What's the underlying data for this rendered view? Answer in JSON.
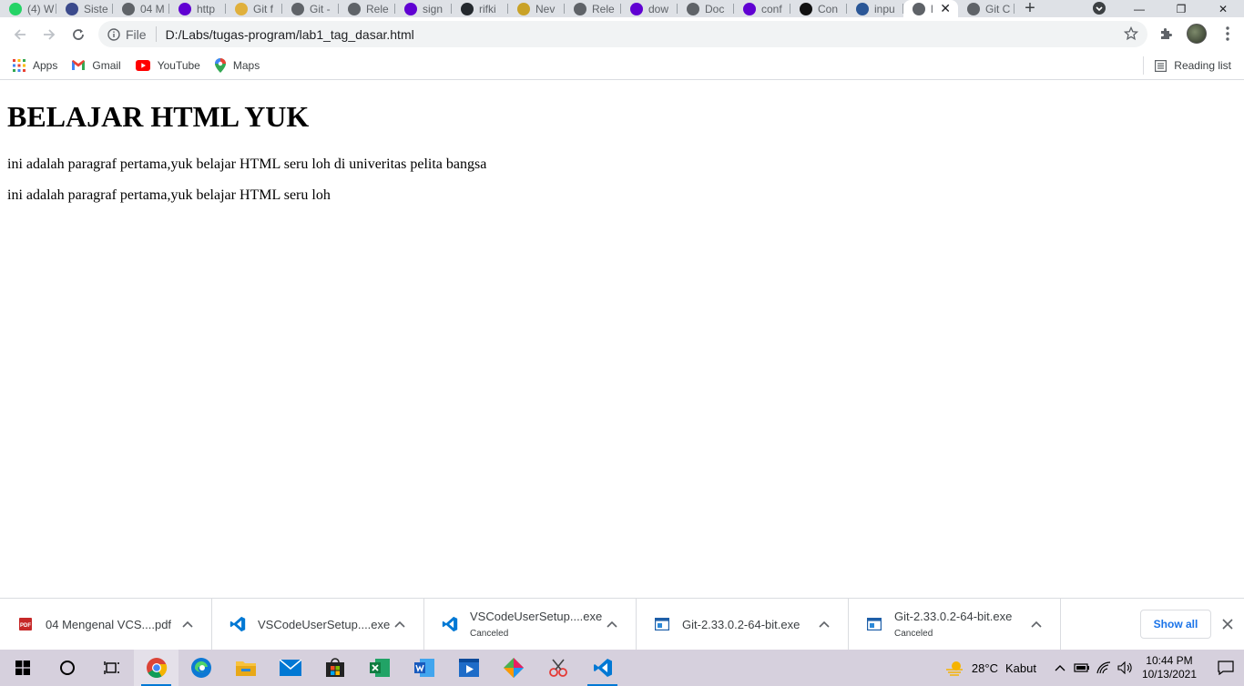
{
  "tabs": [
    {
      "title": "(4) W",
      "icon": "whatsapp-icon",
      "color": "#25d366"
    },
    {
      "title": "Siste",
      "icon": "site-icon",
      "color": "#3b4a8c"
    },
    {
      "title": "04 M",
      "icon": "globe-icon",
      "color": "#5f6368"
    },
    {
      "title": "http",
      "icon": "yahoo-icon",
      "color": "#6001d2"
    },
    {
      "title": "Git f",
      "icon": "git-icon",
      "color": "#e0b03c"
    },
    {
      "title": "Git -",
      "icon": "globe-icon",
      "color": "#5f6368"
    },
    {
      "title": "Rele",
      "icon": "globe-icon",
      "color": "#5f6368"
    },
    {
      "title": "sign",
      "icon": "yahoo-icon",
      "color": "#6001d2"
    },
    {
      "title": "rifki",
      "icon": "github-icon",
      "color": "#24292e"
    },
    {
      "title": "Nev",
      "icon": "crown-icon",
      "color": "#c9a227"
    },
    {
      "title": "Rele",
      "icon": "globe-icon",
      "color": "#5f6368"
    },
    {
      "title": "dow",
      "icon": "yahoo-icon",
      "color": "#6001d2"
    },
    {
      "title": "Doc",
      "icon": "globe-icon",
      "color": "#5f6368"
    },
    {
      "title": "conf",
      "icon": "yahoo-icon",
      "color": "#6001d2"
    },
    {
      "title": "Con",
      "icon": "site-icon",
      "color": "#111111"
    },
    {
      "title": "inpu",
      "icon": "site-icon",
      "color": "#2b5797"
    },
    {
      "title": "l",
      "icon": "globe-icon",
      "color": "#5f6368",
      "active": true
    },
    {
      "title": "Git C",
      "icon": "globe-icon",
      "color": "#5f6368"
    }
  ],
  "address": {
    "scheme_label": "File",
    "url": "D:/Labs/tugas-program/lab1_tag_dasar.html"
  },
  "bookmarks": [
    {
      "label": "Apps",
      "icon": "apps-grid-icon"
    },
    {
      "label": "Gmail",
      "icon": "gmail-icon"
    },
    {
      "label": "YouTube",
      "icon": "youtube-icon"
    },
    {
      "label": "Maps",
      "icon": "maps-icon"
    }
  ],
  "reading_list": "Reading list",
  "page": {
    "heading": "BELAJAR HTML YUK",
    "paragraph1": "ini adalah paragraf pertama,yuk belajar HTML seru loh di univeritas pelita bangsa",
    "paragraph2": "ini adalah paragraf pertama,yuk belajar HTML seru loh"
  },
  "downloads": [
    {
      "name": "04 Mengenal VCS....pdf",
      "status": "",
      "icon": "pdf-icon"
    },
    {
      "name": "VSCodeUserSetup....exe",
      "status": "",
      "icon": "vscode-icon"
    },
    {
      "name": "VSCodeUserSetup....exe",
      "status": "Canceled",
      "icon": "vscode-icon"
    },
    {
      "name": "Git-2.33.0.2-64-bit.exe",
      "status": "",
      "icon": "installer-icon"
    },
    {
      "name": "Git-2.33.0.2-64-bit.exe",
      "status": "Canceled",
      "icon": "installer-icon"
    }
  ],
  "show_all": "Show all",
  "taskbar": {
    "weather_temp": "28°C",
    "weather_desc": "Kabut",
    "time": "10:44 PM",
    "date": "10/13/2021"
  },
  "colors": {
    "tabstrip": "#dee1e6",
    "taskbar": "#d6d0dd",
    "accent": "#1a73e8"
  }
}
